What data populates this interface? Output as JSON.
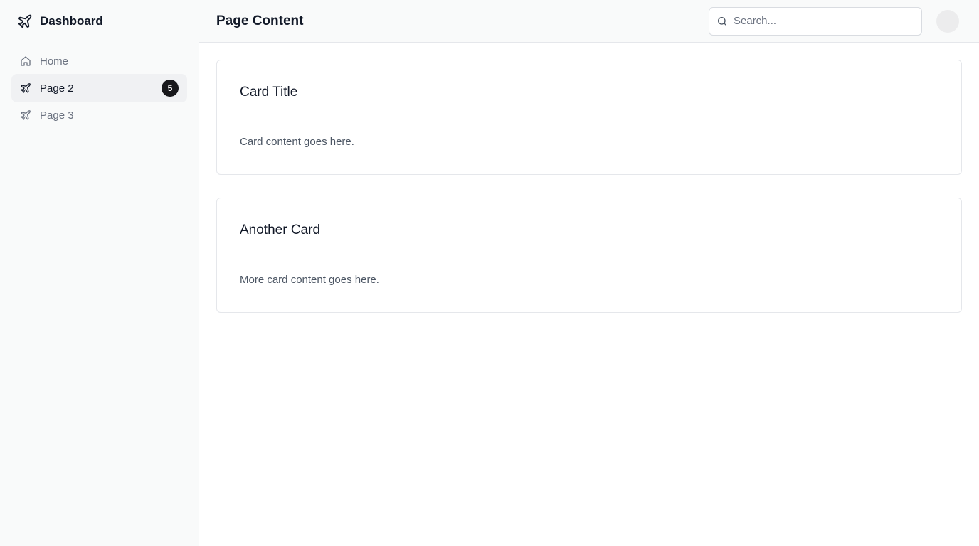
{
  "sidebar": {
    "brand": {
      "title": "Dashboard",
      "icon": "plane-icon"
    },
    "items": [
      {
        "label": "Home",
        "icon": "home-icon",
        "active": false
      },
      {
        "label": "Page 2",
        "icon": "plane-icon",
        "active": true,
        "badge": "5"
      },
      {
        "label": "Page 3",
        "icon": "plane-icon",
        "active": false
      }
    ]
  },
  "header": {
    "title": "Page Content",
    "search": {
      "placeholder": "Search...",
      "value": "",
      "icon": "search-icon"
    },
    "avatar": {
      "icon": "avatar"
    }
  },
  "cards": [
    {
      "title": "Card Title",
      "body": "Card content goes here."
    },
    {
      "title": "Another Card",
      "body": "More card content goes here."
    }
  ],
  "colors": {
    "sidebar_bg": "#f9fafa",
    "active_item_bg": "#f0f1f3",
    "badge_bg": "#18181b",
    "border": "#e5e7eb"
  }
}
